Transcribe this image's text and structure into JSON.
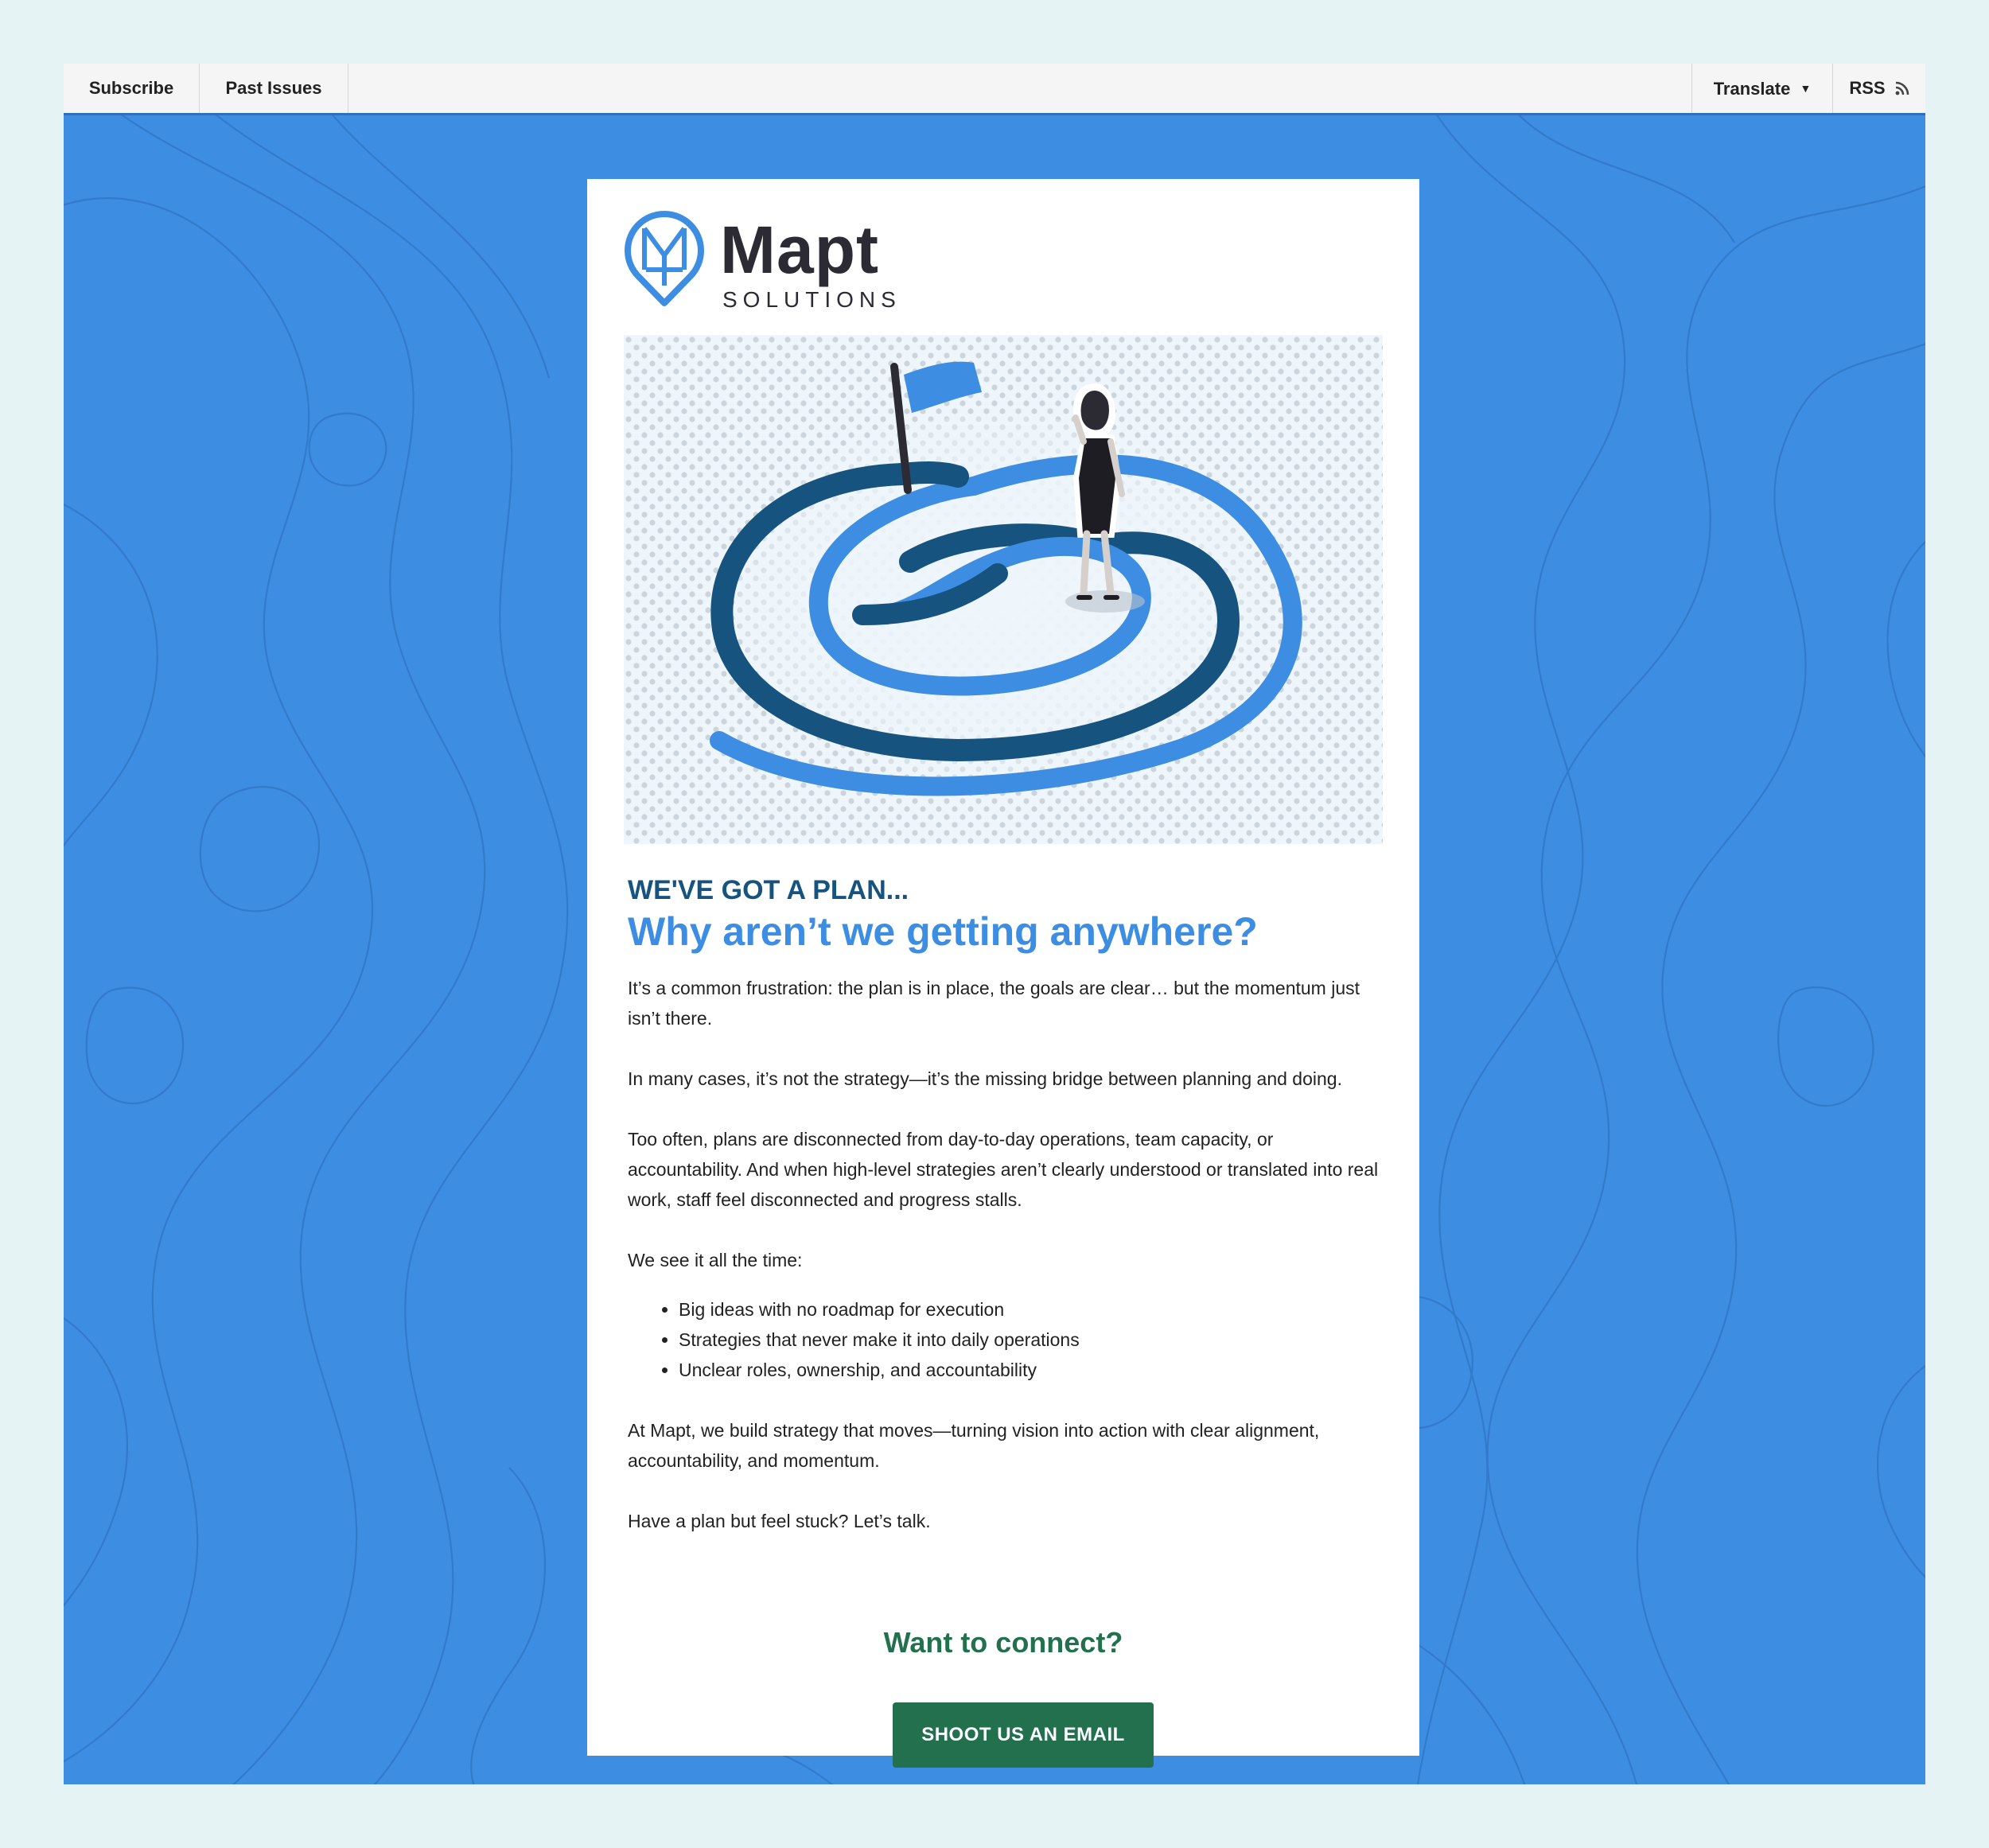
{
  "topbar": {
    "subscribe": "Subscribe",
    "past_issues": "Past Issues",
    "translate": "Translate",
    "rss": "RSS"
  },
  "brand": {
    "name": "Mapt",
    "tagline": "SOLUTIONS",
    "primary_color": "#3d8de2",
    "dark_color": "#16537e",
    "accent_green": "#23704f"
  },
  "hero": {
    "illustration": "spiral-path-with-flag-and-woman"
  },
  "article": {
    "kicker": "WE'VE GOT A PLAN...",
    "headline": "Why aren’t we getting anywhere?",
    "paragraphs": [
      "It’s a common frustration: the plan is in place, the goals are clear… but the momentum just isn’t there.",
      "In many cases, it’s not the strategy—it’s the missing bridge between planning and doing.",
      "Too often, plans are disconnected from day-to-day operations, team capacity, or accountability. And when high-level strategies aren’t clearly understood or translated into real work, staff feel disconnected and progress stalls.",
      "We see it all the time:"
    ],
    "bullets": [
      "Big ideas with no roadmap for execution",
      "Strategies that never make it into daily operations",
      "Unclear roles, ownership, and accountability"
    ],
    "closing": [
      "At Mapt, we build strategy that moves—turning vision into action with clear alignment, accountability, and momentum.",
      "Have a plan but feel stuck? Let’s talk."
    ]
  },
  "cta": {
    "heading": "Want to connect?",
    "button": "SHOOT US AN EMAIL"
  }
}
